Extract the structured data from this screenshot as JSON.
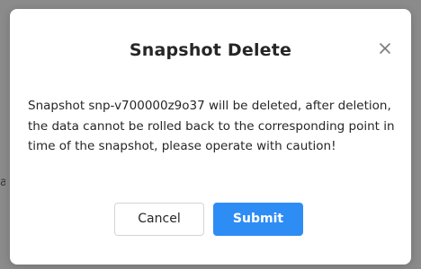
{
  "background": {
    "stub_text": "a"
  },
  "dialog": {
    "title": "Snapshot Delete",
    "message": "Snapshot snp-v700000z9o37 will be deleted, after deletion, the data cannot be rolled back to the corresponding point in time of the snapshot, please operate with caution!",
    "close_icon": "close-icon",
    "cancel_label": "Cancel",
    "submit_label": "Submit"
  },
  "colors": {
    "overlay": "#8b8b8b",
    "primary": "#2e8cf5",
    "text": "#262626",
    "border": "#d4d4d4"
  }
}
